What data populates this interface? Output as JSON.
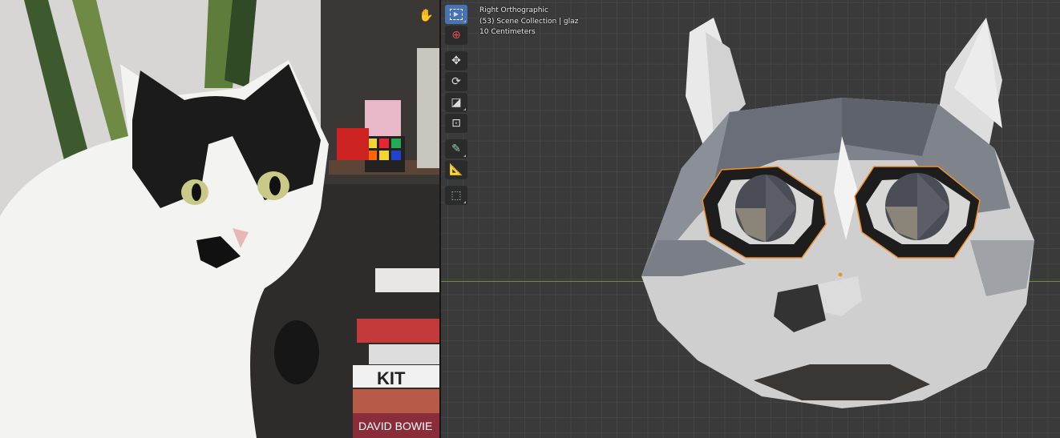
{
  "viewport": {
    "view_name": "Right Orthographic",
    "collection": "(53) Scene Collection | glaz",
    "scale": "10 Centimeters"
  },
  "toolbar": {
    "tools": [
      {
        "name": "select-box",
        "icon": "select-box-icon",
        "active": true
      },
      {
        "name": "cursor",
        "icon": "cursor-icon"
      },
      {
        "name": "move",
        "icon": "move-icon"
      },
      {
        "name": "rotate",
        "icon": "rotate-icon"
      },
      {
        "name": "scale",
        "icon": "scale-icon"
      },
      {
        "name": "transform",
        "icon": "transform-icon"
      },
      {
        "name": "annotate",
        "icon": "annotate-icon"
      },
      {
        "name": "measure",
        "icon": "measure-icon"
      },
      {
        "name": "add-cube",
        "icon": "add-cube-icon"
      }
    ]
  },
  "photo": {
    "book_spines": [
      "KIT",
      "DAVID BOWIE"
    ]
  },
  "colors": {
    "accent": "#4772b3",
    "selection_outline": "#f0902a",
    "x_axis": "#6f8f2f",
    "grid_bg": "#3a3a3a"
  }
}
